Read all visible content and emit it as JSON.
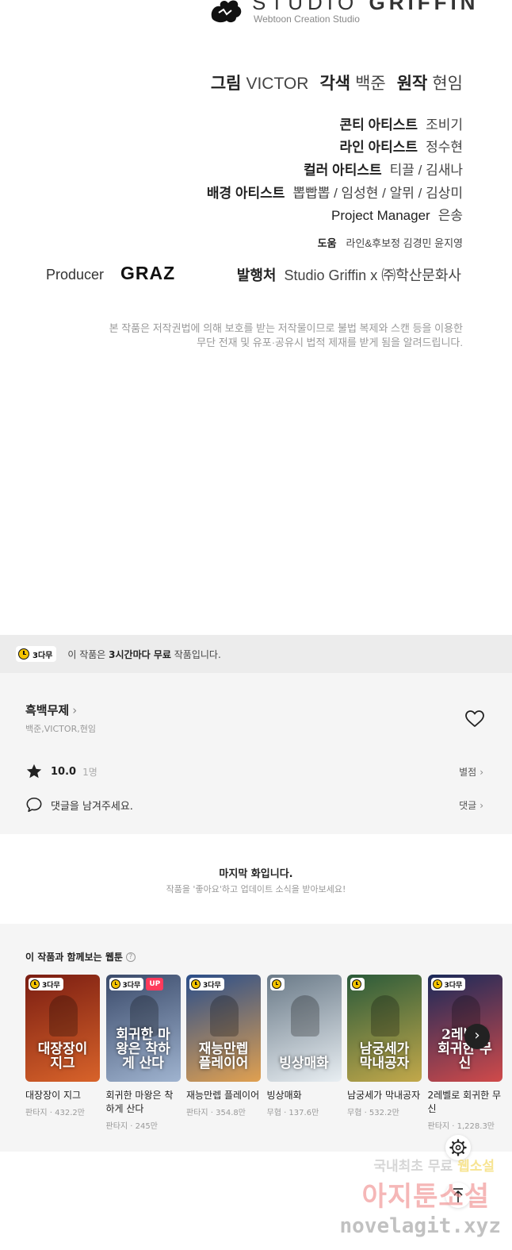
{
  "credits": {
    "studio_name_1": "STUDIO",
    "studio_name_2": "GRIFFIN",
    "studio_tagline": "Webtoon Creation Studio",
    "art_role": "그림",
    "art_name": "VICTOR",
    "adapt_role": "각색",
    "adapt_name": "백준",
    "original_role": "원작",
    "original_name": "현임",
    "conti_role": "콘티 아티스트",
    "conti_name": "조비기",
    "line_role": "라인 아티스트",
    "line_name": "정수현",
    "color_role": "컬러 아티스트",
    "color_name": "티끌 / 김새나",
    "bg_role": "배경 아티스트",
    "bg_name": "뽑빱뽑 / 임성현 / 알뮈 / 김상미",
    "pm_role": "Project Manager",
    "pm_name": "은송",
    "help_role": "도움",
    "help_name": "라인&후보정 김경민 윤지영",
    "producer_label": "Producer",
    "producer_name": "GRAZ",
    "publisher_role": "발행처",
    "publisher_name": "Studio Griffin x ㈜학산문화사",
    "copyright_line1": "본 작품은 저작권법에 의해 보호를 받는 저작물이므로 불법 복제와 스캔 등을 이용한",
    "copyright_line2": "무단 전재 및 유포·공유시 법적 제재를 받게 됨을 알려드립니다."
  },
  "notice": {
    "badge": "3다무",
    "text_pre": "이 작품은 ",
    "text_bold": "3시간마다 무료",
    "text_post": " 작품입니다."
  },
  "info": {
    "title": "흑백무제",
    "title_chevron": "›",
    "authors": "백준,VICTOR,현임",
    "rating": "10.0",
    "rating_count": "1명",
    "rate_link": "별점",
    "comment_placeholder": "댓글을 남겨주세요.",
    "comment_link": "댓글",
    "link_chevron": "›"
  },
  "last": {
    "title": "마지막 화입니다.",
    "subtitle": "작품을 '좋아요'하고 업데이트 소식을 받아보세요!"
  },
  "recs": {
    "title": "이 작품과 함께보는 웹툰",
    "help_icon": "?",
    "next_icon": "›",
    "items": [
      {
        "title": "대장장이 지그",
        "meta": "판타지 · 432.2만",
        "badge": "3다무",
        "up": "",
        "art": "대장장이 지그",
        "bg1": "#7a1d12",
        "bg2": "#d8632a"
      },
      {
        "title": "회귀한 마왕은 착하게 산다",
        "meta": "판타지 · 245만",
        "badge": "3다무",
        "up": "UP",
        "art": "회귀한 마왕은 착하게 산다",
        "bg1": "#3a4a6a",
        "bg2": "#9fb3cf"
      },
      {
        "title": "재능만렙 플레이어",
        "meta": "판타지 · 354.8만",
        "badge": "3다무",
        "up": "",
        "art": "재능만렙 플레이어",
        "bg1": "#2a4e8a",
        "bg2": "#e0a050"
      },
      {
        "title": "빙상매화",
        "meta": "무협 · 137.6만",
        "badge": "",
        "up": "",
        "art": "빙상매화",
        "bg1": "#6a7a88",
        "bg2": "#e8eef2"
      },
      {
        "title": "남궁세가 막내공자",
        "meta": "무협 · 532.2만",
        "badge": "",
        "up": "",
        "art": "남궁세가 막내공자",
        "bg1": "#2a5a3a",
        "bg2": "#c2a84a"
      },
      {
        "title": "2레벨로 회귀한 무신",
        "meta": "판타지 · 1,228.3만",
        "badge": "3다무",
        "up": "",
        "art": "2레벨로 회귀한 무신",
        "bg1": "#1a2a5a",
        "bg2": "#d04a4a"
      }
    ]
  },
  "floating": {
    "top_icon": "↑"
  },
  "watermark": {
    "line1_pre": "국내최초 무료 ",
    "line1_hl": "웹소설",
    "line2": "아지툰소설",
    "line3": "novelagit.xyz"
  }
}
